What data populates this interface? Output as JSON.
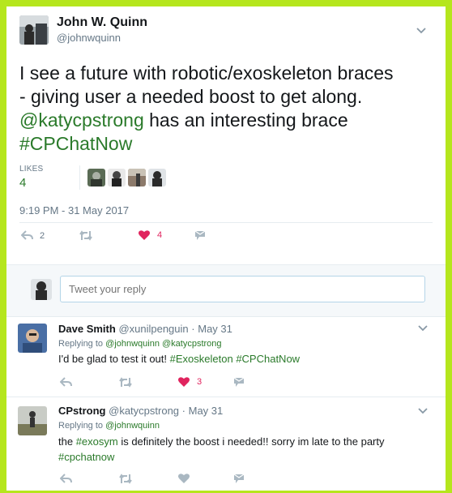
{
  "main_tweet": {
    "author_name": "John W. Quinn",
    "author_handle": "@johnwquinn",
    "text_lines": {
      "l1": "I see a future with robotic/exoskeleton braces",
      "l2": "- giving user a needed boost to get along.",
      "mention": "@katycpstrong",
      "l3_rest": " has an interesting brace",
      "hashtag": "#CPChatNow"
    },
    "likes_label": "LIKES",
    "likes_count": "4",
    "timestamp": "9:19 PM - 31 May 2017",
    "actions": {
      "reply_count": "2",
      "like_count": "4"
    }
  },
  "reply_box": {
    "placeholder": "Tweet your reply"
  },
  "replies": [
    {
      "name": "Dave Smith",
      "handle": "@xunilpenguin",
      "dot": "·",
      "date": "May 31",
      "replying_prefix": "Replying to",
      "replying_to": [
        "@johnwquinn",
        "@katycpstrong"
      ],
      "text_parts": [
        "I'd be glad to test it out! ",
        "#Exoskeleton",
        " ",
        "#CPChatNow"
      ],
      "like_count": "3"
    },
    {
      "name": "CPstrong",
      "handle": "@katycpstrong",
      "dot": "·",
      "date": "May 31",
      "replying_prefix": "Replying to",
      "replying_to": [
        "@johnwquinn"
      ],
      "text_parts": [
        "the ",
        "#exosym",
        " is definitely the boost i needed!! sorry im late to the party"
      ],
      "text_line2": "#cpchatnow"
    }
  ],
  "colors": {
    "page_border": "#b5e61d",
    "link_green": "#2a7a2a",
    "link_blue": "#1b95e0",
    "heart": "#e0245e",
    "meta_gray": "#657786"
  }
}
